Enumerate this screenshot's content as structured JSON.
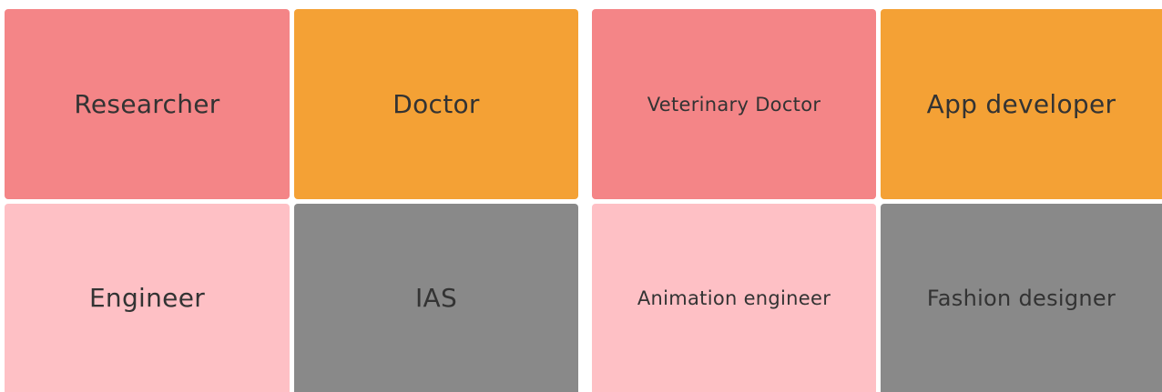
{
  "cards": [
    {
      "label": "Researcher",
      "color": "#f48587"
    },
    {
      "label": "Doctor",
      "color": "#f4a135"
    },
    {
      "label": "Veterinary Doctor",
      "color": "#f48587"
    },
    {
      "label": "App developer",
      "color": "#f4a135"
    },
    {
      "label": "Engineer",
      "color": "#fec0c5"
    },
    {
      "label": "IAS",
      "color": "#898989"
    },
    {
      "label": "Animation engineer",
      "color": "#fec0c5"
    },
    {
      "label": "Fashion designer",
      "color": "#898989"
    }
  ]
}
